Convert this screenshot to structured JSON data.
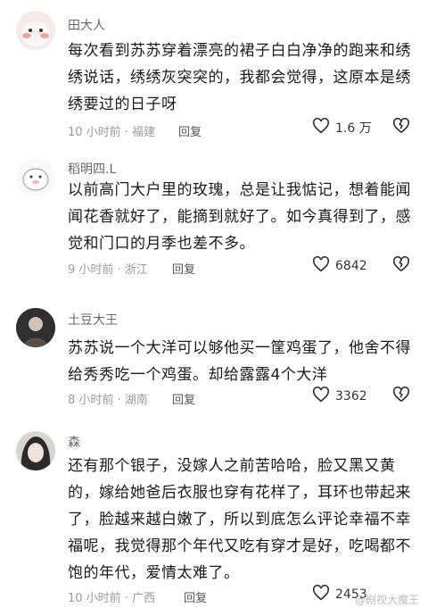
{
  "comments": [
    {
      "username": "田大人",
      "lines": [
        "每次看到苏苏穿着漂亮的裙子白白净净的跑来和绣",
        "绣说话，绣绣灰突突的，我都会觉得，这原本是绣",
        "绣要过的日子呀"
      ],
      "time": "10 小时前 · 福建",
      "reply": "回复",
      "likes": "1.6 万"
    },
    {
      "username": "稻明四.L",
      "lines": [
        "以前高门大户里的玫瑰，总是让我惦记，想着能闻",
        "闻花香就好了，能摘到就好了。如今真得到了，感",
        "觉和门口的月季也差不多。"
      ],
      "time": "9 小时前 · 浙江",
      "reply": "回复",
      "likes": "6842"
    },
    {
      "username": "土豆大王",
      "lines": [
        "苏苏说一个大洋可以够他买一筐鸡蛋了，他舍不得",
        "给秀秀吃一个鸡蛋。却给露露4个大洋"
      ],
      "time": "8 小时前 · 湖南",
      "reply": "回复",
      "likes": "3362"
    },
    {
      "username": "森",
      "lines": [
        "还有那个银子，没嫁人之前苦哈哈，脸又黑又黄",
        "的，嫁给她爸后衣服也穿有花样了，耳环也带起来",
        "了，脸越来越白嫩了，所以到底怎么评论幸福不幸",
        "福呢，我觉得那个年代又吃有穿才是好，吃喝都不",
        "饱的年代，爱情太难了。"
      ],
      "time": "10 小时前 · 广西",
      "reply": "回复",
      "likes": "2453"
    }
  ],
  "watermark": "@剧视大魔王",
  "icons": {
    "like": "heart-outline-icon",
    "dislike": "broken-heart-icon"
  }
}
